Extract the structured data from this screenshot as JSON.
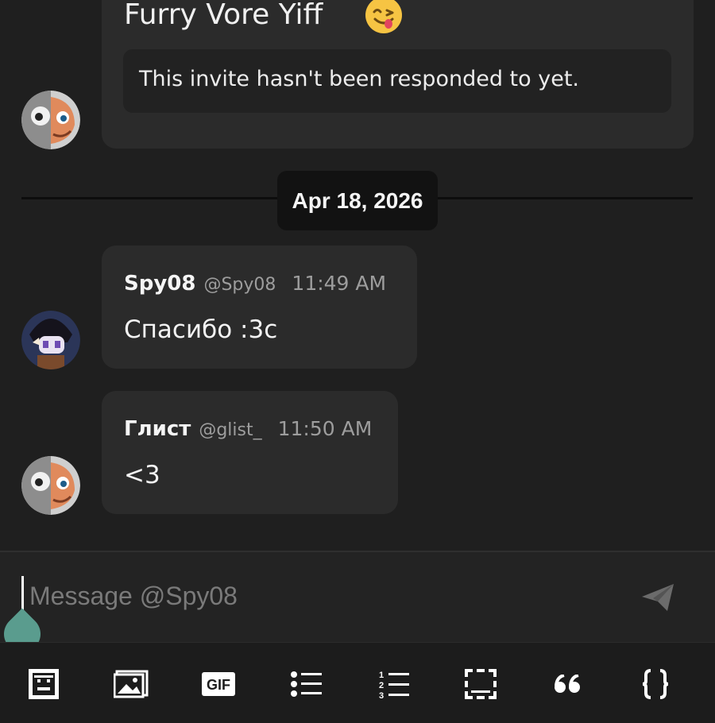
{
  "invite": {
    "title": "Furry Vore Yiff",
    "status": "This invite hasn't been responded to yet."
  },
  "divider": {
    "date": "Apr 18, 2026"
  },
  "messages": [
    {
      "author": "Spy08",
      "handle": "@Spy08",
      "time": "11:49 AM",
      "text": "Спасибо :3с"
    },
    {
      "author": "Глист",
      "handle": "@glist_",
      "time": "11:50 AM",
      "text": "<3"
    }
  ],
  "composer": {
    "placeholder": "Message @Spy08",
    "value": ""
  },
  "toolbar": {
    "items": [
      "sticker-icon",
      "image-icon",
      "gif-icon",
      "bullet-list-icon",
      "numbered-list-icon",
      "spoiler-icon",
      "quote-icon",
      "code-braces-icon"
    ],
    "gif_label": "GIF"
  },
  "colors": {
    "background": "#1f1f1f",
    "bubble": "#2b2b2b",
    "date_pill": "#121212",
    "caret_handle": "#5a9c8e",
    "send_icon": "#6b6b6b"
  }
}
